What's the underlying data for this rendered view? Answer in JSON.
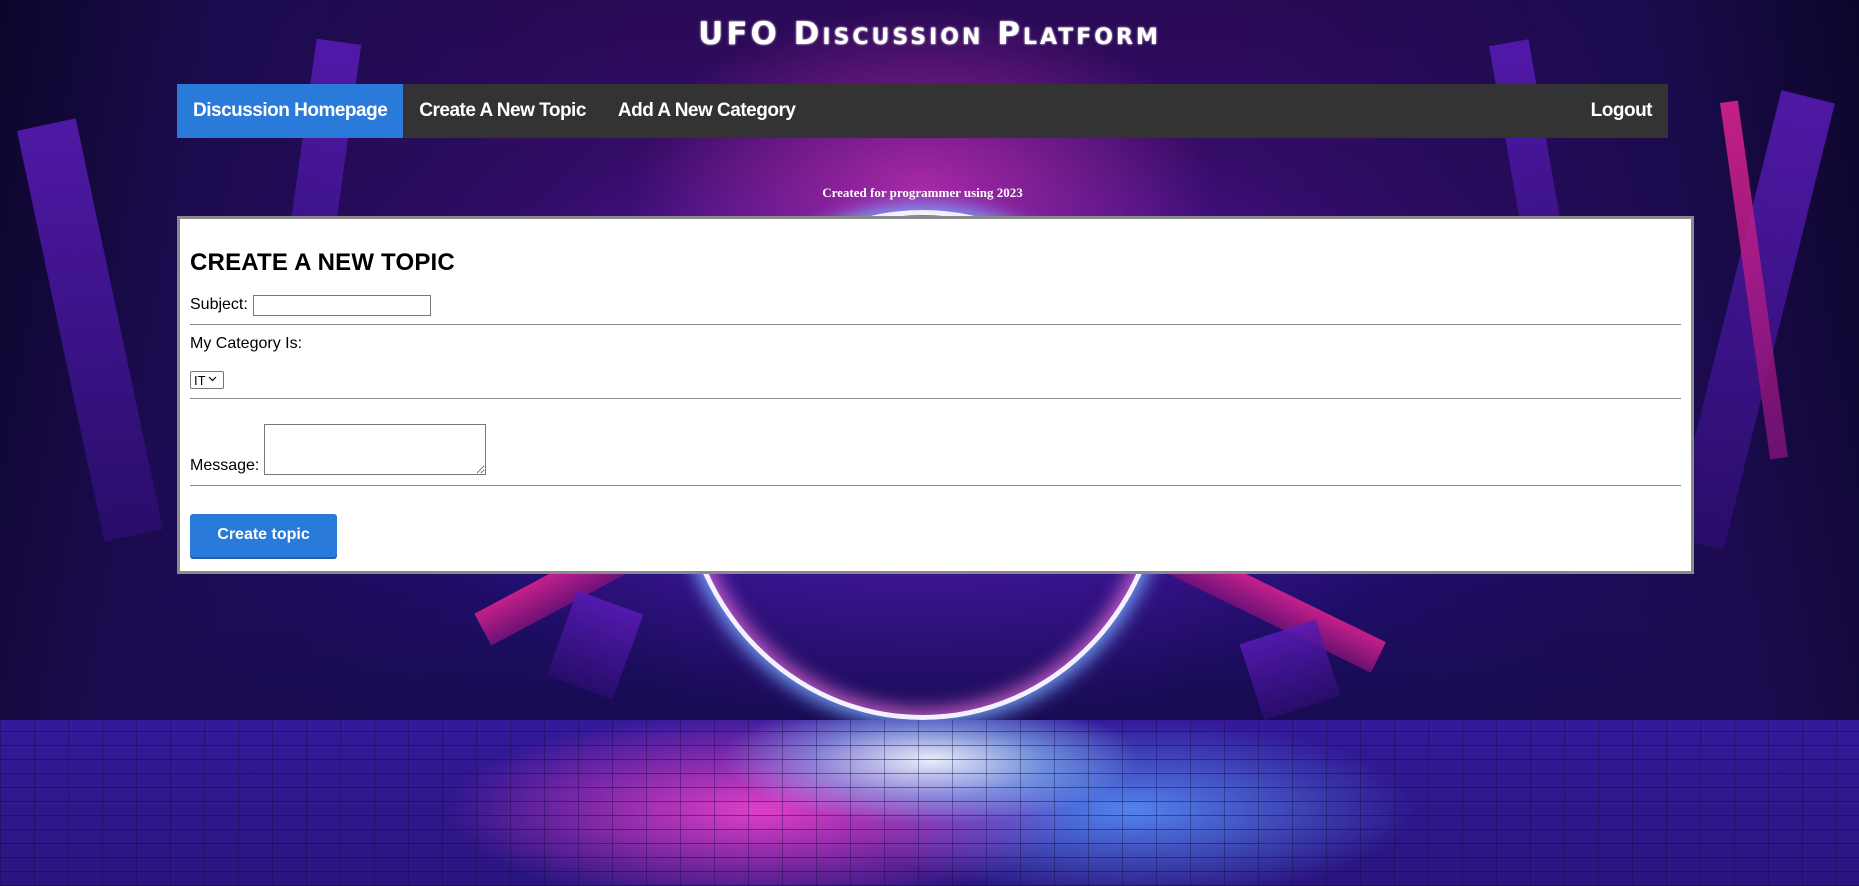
{
  "site": {
    "title": "UFO Discussion Platform"
  },
  "nav": {
    "items": [
      {
        "label": "Discussion Homepage",
        "active": true
      },
      {
        "label": "Create A New Topic",
        "active": false
      },
      {
        "label": "Add A New Category",
        "active": false
      }
    ],
    "logout_label": "Logout"
  },
  "credit": "Created for programmer using 2023",
  "form": {
    "heading": "CREATE A NEW TOPIC",
    "subject_label": "Subject:",
    "subject_value": "",
    "category_label": "My Category Is:",
    "category_selected": "IT",
    "message_label": "Message:",
    "message_value": "",
    "submit_label": "Create topic"
  },
  "colors": {
    "nav_background": "#333333",
    "nav_active": "#2a7ad9",
    "button": "#2a7ad9",
    "panel_background": "#ffffff"
  },
  "icons": {
    "select_arrow": "chevron-down-icon"
  }
}
